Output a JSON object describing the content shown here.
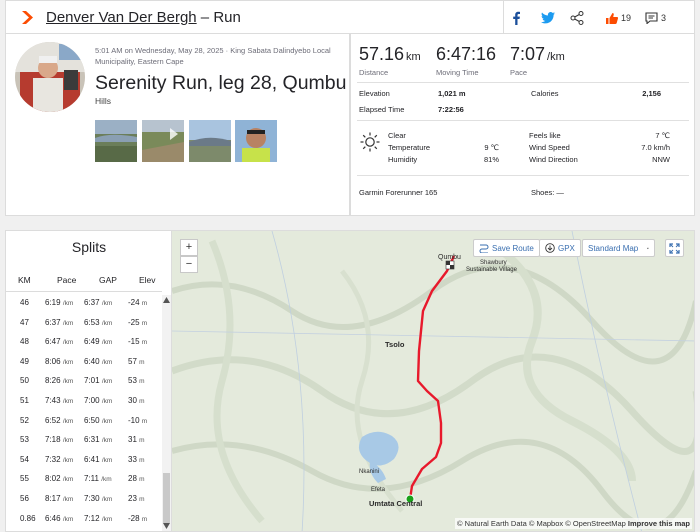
{
  "header": {
    "athlete": "Denver Van Der Bergh",
    "separator_type": " – Run",
    "likes": "19",
    "comments": "3"
  },
  "activity": {
    "datetime_location": "5:01 AM on Wednesday, May 28, 2025 · King Sabata Dalindyebo Local Municipality, Eastern Cape",
    "title": "Serenity Run, leg 28, Qumbu",
    "subtitle": "Hills"
  },
  "stats": {
    "distance": {
      "value": "57.16",
      "unit": "km",
      "label": "Distance"
    },
    "moving_time": {
      "value": "6:47:16",
      "label": "Moving Time"
    },
    "pace": {
      "value": "7:07",
      "unit": "/km",
      "label": "Pace"
    },
    "elevation_label": "Elevation",
    "elevation_value": "1,021 m",
    "calories_label": "Calories",
    "calories_value": "2,156",
    "elapsed_label": "Elapsed Time",
    "elapsed_value": "7:22:56"
  },
  "weather": {
    "condition": "Clear",
    "temperature_label": "Temperature",
    "temperature_value": "9 ℃",
    "humidity_label": "Humidity",
    "humidity_value": "81%",
    "feels_label": "Feels like",
    "feels_value": "7 ℃",
    "wind_speed_label": "Wind Speed",
    "wind_speed_value": "7.0 km/h",
    "wind_dir_label": "Wind Direction",
    "wind_dir_value": "NNW"
  },
  "gear": {
    "device": "Garmin Forerunner 165",
    "shoes": "Shoes: —"
  },
  "splits": {
    "title": "Splits",
    "headers": [
      "KM",
      "Pace",
      "GAP",
      "Elev"
    ],
    "rows": [
      {
        "km": "46",
        "pace": "6:19",
        "gap": "6:37",
        "elev": "-24"
      },
      {
        "km": "47",
        "pace": "6:37",
        "gap": "6:53",
        "elev": "-25"
      },
      {
        "km": "48",
        "pace": "6:47",
        "gap": "6:49",
        "elev": "-15"
      },
      {
        "km": "49",
        "pace": "8:06",
        "gap": "6:40",
        "elev": "57"
      },
      {
        "km": "50",
        "pace": "8:26",
        "gap": "7:01",
        "elev": "53"
      },
      {
        "km": "51",
        "pace": "7:43",
        "gap": "7:00",
        "elev": "30"
      },
      {
        "km": "52",
        "pace": "6:52",
        "gap": "6:50",
        "elev": "-10"
      },
      {
        "km": "53",
        "pace": "7:18",
        "gap": "6:31",
        "elev": "31"
      },
      {
        "km": "54",
        "pace": "7:32",
        "gap": "6:41",
        "elev": "33"
      },
      {
        "km": "55",
        "pace": "8:02",
        "gap": "7:11",
        "elev": "28"
      },
      {
        "km": "56",
        "pace": "8:17",
        "gap": "7:30",
        "elev": "23"
      },
      {
        "km": "0.86",
        "pace": "6:46",
        "gap": "7:12",
        "elev": "-28"
      }
    ],
    "pace_unit": "/km",
    "elev_unit": "m"
  },
  "map": {
    "zoom_in": "+",
    "zoom_out": "−",
    "save_route": "Save Route",
    "gpx": "GPX",
    "map_style": "Standard Map",
    "places": {
      "qumbu": "Qumbu",
      "shawbury": "Shawbury",
      "sustainable": "Sustainable Village",
      "tsolo": "Tsolo",
      "nkanini": "Nkanini",
      "efeta": "Efeta",
      "umtata": "Umtata Central"
    },
    "attribution": "© Natural Earth Data © Mapbox © OpenStreetMap",
    "improve": "Improve this map",
    "route_color": "#e8192c",
    "start_color": "#1aa11a"
  }
}
